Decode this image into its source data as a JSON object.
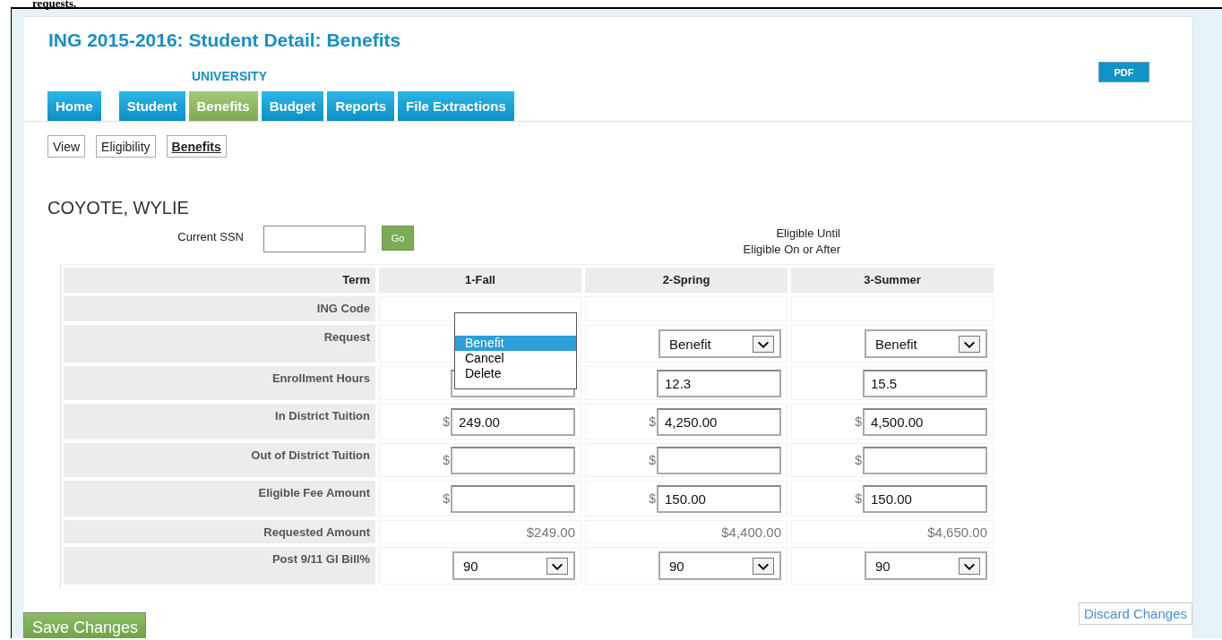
{
  "caption": "requests.",
  "header": {
    "title": "ING 2015-2016: Student Detail: Benefits",
    "institution": "UNIVERSITY",
    "pdf_button": "PDF"
  },
  "tabs": [
    {
      "label": "Home",
      "selected": false
    },
    {
      "label": "Student",
      "selected": false
    },
    {
      "label": "Benefits",
      "selected": true
    },
    {
      "label": "Budget",
      "selected": false
    },
    {
      "label": "Reports",
      "selected": false
    },
    {
      "label": "File Extractions",
      "selected": false
    }
  ],
  "subtabs": [
    {
      "label": "View",
      "selected": false
    },
    {
      "label": "Eligibility",
      "selected": false
    },
    {
      "label": "Benefits",
      "selected": true
    }
  ],
  "student_name": "COYOTE, WYLIE",
  "ssn": {
    "label": "Current SSN",
    "go_button": "Go"
  },
  "eligibility_labels": [
    "Eligible Until",
    "Eligible On or After"
  ],
  "table": {
    "corner": "Term",
    "terms": [
      "1-Fall",
      "2-Spring",
      "3-Summer"
    ],
    "rows": [
      {
        "label": "ING Code",
        "kind": "blank"
      },
      {
        "label": "Request",
        "kind": "select",
        "cells": [
          {
            "open": true,
            "options": [
              {
                "label": "Benefit",
                "selected": true
              },
              {
                "label": "Cancel",
                "selected": false
              },
              {
                "label": "Delete",
                "selected": false
              }
            ]
          },
          {
            "open": false,
            "value": "Benefit"
          },
          {
            "open": false,
            "value": "Benefit"
          }
        ]
      },
      {
        "label": "Enrollment Hours",
        "kind": "input",
        "cells": [
          {},
          {
            "value": "12.3"
          },
          {
            "value": "15.5"
          }
        ]
      },
      {
        "label": "In District Tuition",
        "kind": "money",
        "currency": "$",
        "cells": [
          {
            "value": "249.00"
          },
          {
            "value": "4,250.00"
          },
          {
            "value": "4,500.00"
          }
        ]
      },
      {
        "label": "Out of District Tuition",
        "kind": "money",
        "currency": "$",
        "cells": [
          {},
          {},
          {}
        ]
      },
      {
        "label": "Eligible Fee Amount",
        "kind": "money",
        "currency": "$",
        "cells": [
          {},
          {
            "value": "150.00"
          },
          {
            "value": "150.00"
          }
        ]
      },
      {
        "label": "Requested Amount",
        "kind": "amount",
        "cells": [
          {
            "value": "$249.00"
          },
          {
            "value": "$4,400.00"
          },
          {
            "value": "$4,650.00"
          }
        ]
      },
      {
        "label": "Post 9/11 GI Bill%",
        "kind": "select",
        "cells": [
          {
            "open": false,
            "value": "90"
          },
          {
            "open": false,
            "value": "90"
          },
          {
            "open": false,
            "value": "90"
          }
        ]
      }
    ]
  },
  "footer": {
    "save_button": "Save Changes",
    "discard_button": "Discard Changes"
  }
}
